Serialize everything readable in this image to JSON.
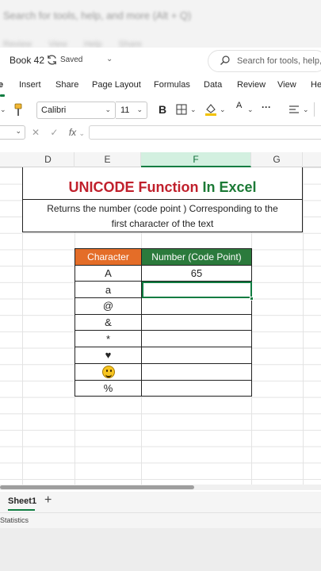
{
  "topbar": {
    "search_hint": "Search for tools, help, and more (Alt + Q)",
    "tabs_hint": "Review View Help Share"
  },
  "titlebar": {
    "book_name": "Book 42",
    "save_status": "Saved",
    "search_placeholder": "Search for tools, help,"
  },
  "ribbon": {
    "tabs": [
      "e",
      "Insert",
      "Share",
      "Page Layout",
      "Formulas",
      "Data",
      "Review",
      "View",
      "He"
    ]
  },
  "toolbar": {
    "font_name": "Calibri",
    "font_size": "11",
    "bold_label": "B",
    "font_color_label": "A",
    "more_label": "···"
  },
  "formula_bar": {
    "fx_label": "fx"
  },
  "columns": [
    "D",
    "E",
    "F",
    "G"
  ],
  "selected_column": "F",
  "sheet": {
    "title_part1": "UNICODE Function",
    "title_part2": "In Excel",
    "description_line1": "Returns the number (code point ) Corresponding to the",
    "description_line2": "first character of the text",
    "table_headers": [
      "Character",
      "Number (Code Point)"
    ],
    "rows": [
      {
        "char": "A",
        "num": "65"
      },
      {
        "char": "a",
        "num": ""
      },
      {
        "char": "@",
        "num": ""
      },
      {
        "char": "&",
        "num": ""
      },
      {
        "char": "*",
        "num": ""
      },
      {
        "char": "♥",
        "num": ""
      },
      {
        "char": "",
        "num": "",
        "icon": "smiling-face-emoji-icon"
      },
      {
        "char": "%",
        "num": ""
      }
    ]
  },
  "bottom": {
    "sheet_tab": "Sheet1",
    "add_label": "+",
    "status": "Statistics"
  },
  "colors": {
    "excel_green": "#107c41",
    "header_orange": "#e46d28",
    "header_green": "#2b7a3c",
    "title_red": "#c0202c",
    "title_green": "#1c7a36"
  }
}
